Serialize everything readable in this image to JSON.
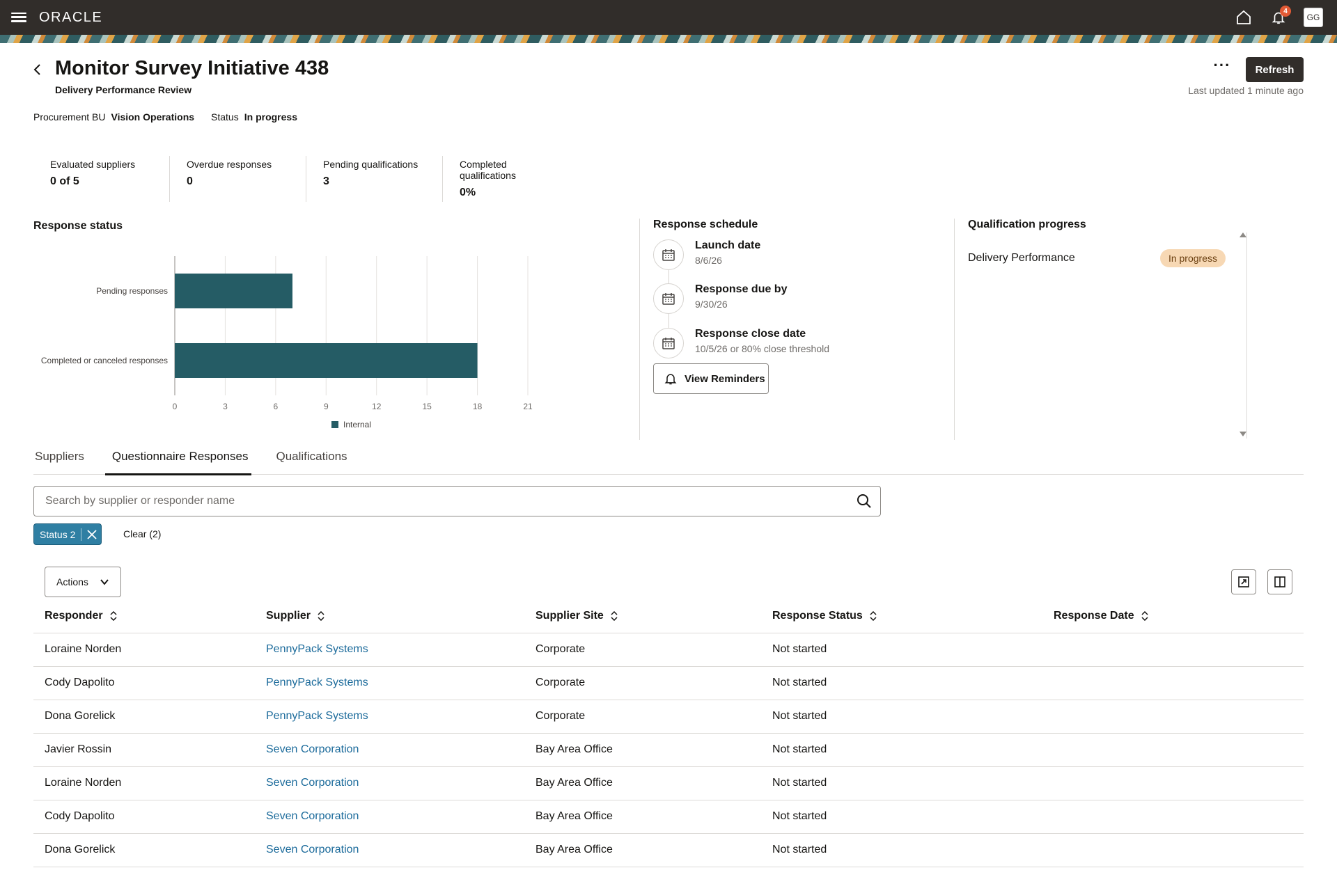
{
  "topbar": {
    "brand": "ORACLE",
    "notification_count": "4",
    "avatar_initials": "GG"
  },
  "header": {
    "title": "Monitor Survey Initiative 438",
    "subtitle": "Delivery Performance Review",
    "refresh_label": "Refresh",
    "more_label": "···",
    "last_updated": "Last updated 1 minute ago"
  },
  "meta": {
    "bu_label": "Procurement BU",
    "bu_value": "Vision Operations",
    "status_label": "Status",
    "status_value": "In progress"
  },
  "metrics": [
    {
      "label": "Evaluated suppliers",
      "value": "0 of 5"
    },
    {
      "label": "Overdue responses",
      "value": "0"
    },
    {
      "label": "Pending qualifications",
      "value": "3"
    },
    {
      "label": "Completed qualifications",
      "value": "0%"
    }
  ],
  "response_status": {
    "heading": "Response status",
    "chart_data": {
      "type": "bar",
      "orientation": "horizontal",
      "categories": [
        "Pending responses",
        "Completed or canceled responses"
      ],
      "series": [
        {
          "name": "Internal",
          "values": [
            7,
            18
          ]
        }
      ],
      "xlim": [
        0,
        21
      ],
      "xticks": [
        "0",
        "3",
        "6",
        "9",
        "12",
        "15",
        "18",
        "21"
      ],
      "grid": true,
      "legend": "bottom",
      "colors": [
        "#255c65"
      ]
    }
  },
  "schedule": {
    "heading": "Response schedule",
    "items": [
      {
        "title": "Launch date",
        "value": "8/6/26"
      },
      {
        "title": "Response due by",
        "value": "9/30/26"
      },
      {
        "title": "Response close date",
        "value": "10/5/26 or 80% close threshold"
      }
    ],
    "reminders_label": "View Reminders"
  },
  "qualification": {
    "heading": "Qualification progress",
    "items": [
      {
        "name": "Delivery Performance",
        "status": "In progress"
      }
    ]
  },
  "tabs": [
    {
      "label": "Suppliers",
      "active": false
    },
    {
      "label": "Questionnaire Responses",
      "active": true
    },
    {
      "label": "Qualifications",
      "active": false
    }
  ],
  "search": {
    "placeholder": "Search by supplier or responder name",
    "value": ""
  },
  "filters": {
    "chip_label": "Status 2",
    "clear_label": "Clear (2)"
  },
  "toolbar": {
    "actions_label": "Actions"
  },
  "table": {
    "columns": [
      "Responder",
      "Supplier",
      "Supplier Site",
      "Response Status",
      "Response Date"
    ],
    "rows": [
      {
        "responder": "Loraine Norden",
        "supplier": "PennyPack Systems",
        "site": "Corporate",
        "status": "Not started",
        "date": ""
      },
      {
        "responder": "Cody Dapolito",
        "supplier": "PennyPack Systems",
        "site": "Corporate",
        "status": "Not started",
        "date": ""
      },
      {
        "responder": "Dona Gorelick",
        "supplier": "PennyPack Systems",
        "site": "Corporate",
        "status": "Not started",
        "date": ""
      },
      {
        "responder": "Javier Rossin",
        "supplier": "Seven Corporation",
        "site": "Bay Area Office",
        "status": "Not started",
        "date": ""
      },
      {
        "responder": "Loraine Norden",
        "supplier": "Seven Corporation",
        "site": "Bay Area Office",
        "status": "Not started",
        "date": ""
      },
      {
        "responder": "Cody Dapolito",
        "supplier": "Seven Corporation",
        "site": "Bay Area Office",
        "status": "Not started",
        "date": ""
      },
      {
        "responder": "Dona Gorelick",
        "supplier": "Seven Corporation",
        "site": "Bay Area Office",
        "status": "Not started",
        "date": ""
      }
    ]
  }
}
